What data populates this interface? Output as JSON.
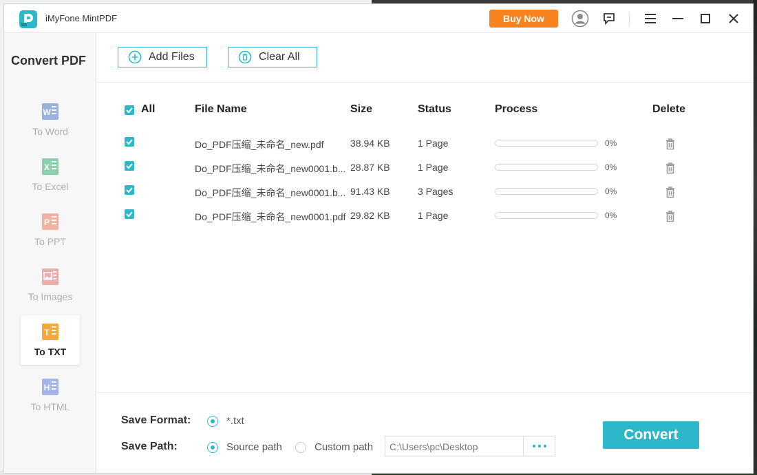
{
  "app": {
    "title": "iMyFone MintPDF",
    "buy_now": "Buy Now"
  },
  "sidebar": {
    "title": "Convert PDF",
    "items": [
      {
        "label": "To Word",
        "letter": "W",
        "color": "#7f9fd8",
        "active": false
      },
      {
        "label": "To Excel",
        "letter": "X",
        "color": "#6fc59a",
        "active": false
      },
      {
        "label": "To PPT",
        "letter": "P",
        "color": "#f0a08a",
        "active": false
      },
      {
        "label": "To Images",
        "letter": "",
        "color": "#ea9a9a",
        "active": false
      },
      {
        "label": "To TXT",
        "letter": "T",
        "color": "#f2a93b",
        "active": true
      },
      {
        "label": "To HTML",
        "letter": "H",
        "color": "#8fa3e6",
        "active": false
      }
    ]
  },
  "toolbar": {
    "add_files": "Add Files",
    "clear_all": "Clear All"
  },
  "table": {
    "headers": {
      "all": "All",
      "file_name": "File Name",
      "size": "Size",
      "status": "Status",
      "process": "Process",
      "delete": "Delete"
    },
    "rows": [
      {
        "name": "Do_PDF压缩_未命名_new.pdf",
        "size": "38.94 KB",
        "status": "1 Page",
        "progress": "0%",
        "checked": true
      },
      {
        "name": "Do_PDF压缩_未命名_new0001.b...",
        "size": "28.87 KB",
        "status": "1 Page",
        "progress": "0%",
        "checked": true
      },
      {
        "name": "Do_PDF压缩_未命名_new0001.b...",
        "size": "91.43 KB",
        "status": "3 Pages",
        "progress": "0%",
        "checked": true
      },
      {
        "name": "Do_PDF压缩_未命名_new0001.pdf",
        "size": "29.82 KB",
        "status": "1 Page",
        "progress": "0%",
        "checked": true
      }
    ]
  },
  "bottom": {
    "save_format_label": "Save Format:",
    "format_option": "*.txt",
    "save_path_label": "Save Path:",
    "source_path": "Source path",
    "custom_path": "Custom path",
    "path_value": "C:\\Users\\pc\\Desktop",
    "convert": "Convert"
  },
  "colors": {
    "accent": "#2cb8c9",
    "buy": "#f6831f"
  }
}
